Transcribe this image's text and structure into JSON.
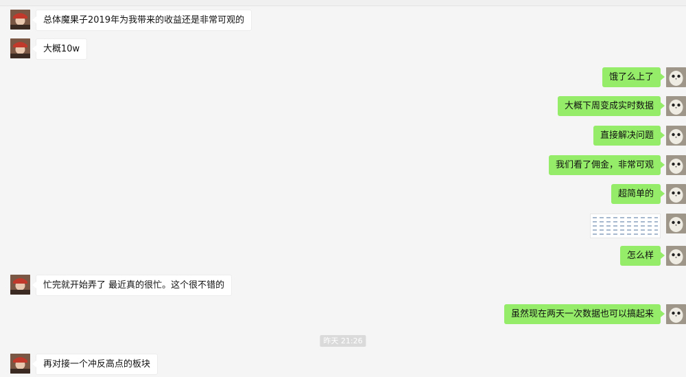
{
  "messages": [
    {
      "side": "left",
      "text": "总体魔果子2019年为我带来的收益还是非常可观的"
    },
    {
      "side": "left",
      "text": "大概10w"
    },
    {
      "side": "right",
      "text": "饿了么上了"
    },
    {
      "side": "right",
      "text": "大概下周变成实时数据"
    },
    {
      "side": "right",
      "text": "直接解决问题"
    },
    {
      "side": "right",
      "text": "我们看了佣金，非常可观"
    },
    {
      "side": "right",
      "text": "超简单的"
    },
    {
      "side": "right",
      "type": "image"
    },
    {
      "side": "right",
      "text": "怎么样"
    },
    {
      "side": "left",
      "text": "忙完就开始弄了 最近真的很忙。这个很不错的"
    },
    {
      "side": "right",
      "text": "虽然现在两天一次数据也可以搞起来"
    },
    {
      "side": "left",
      "text": "再对接一个冲反高点的板块"
    }
  ],
  "timestamp": "昨天 21:26"
}
